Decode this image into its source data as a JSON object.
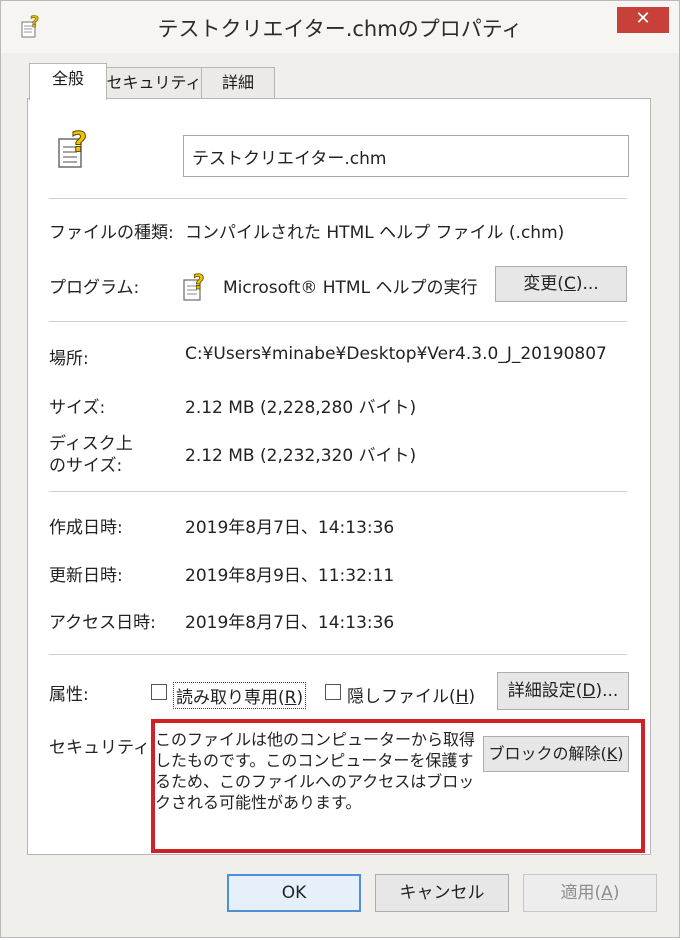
{
  "window": {
    "title": "テストクリエイター.chmのプロパティ",
    "close_glyph": "✕"
  },
  "tabs": [
    {
      "label": "全般"
    },
    {
      "label": "セキュリティ"
    },
    {
      "label": "詳細"
    }
  ],
  "general": {
    "file_name": "テストクリエイター.chm",
    "file_type_label": "ファイルの種類:",
    "file_type_value": "コンパイルされた HTML ヘルプ ファイル (.chm)",
    "program_label": "プログラム:",
    "program_value": "Microsoft® HTML ヘルプの実行",
    "change_button": {
      "prefix": "変更(",
      "key": "C",
      "suffix": ")..."
    },
    "location_label": "場所:",
    "location_value": "C:¥Users¥minabe¥Desktop¥Ver4.3.0_J_20190807",
    "size_label": "サイズ:",
    "size_value": "2.12 MB (2,228,280 バイト)",
    "disk_size_label_1": "ディスク上",
    "disk_size_label_2": "のサイズ:",
    "disk_size_value": "2.12 MB (2,232,320 バイト)",
    "created_label": "作成日時:",
    "created_value": "2019年8月7日、14:13:36",
    "modified_label": "更新日時:",
    "modified_value": "2019年8月9日、11:32:11",
    "accessed_label": "アクセス日時:",
    "accessed_value": "2019年8月7日、14:13:36",
    "attributes_label": "属性:",
    "readonly": {
      "prefix": "読み取り専用(",
      "key": "R",
      "suffix": ")",
      "checked": false
    },
    "hidden": {
      "prefix": "隠しファイル(",
      "key": "H",
      "suffix": ")",
      "checked": false
    },
    "advanced_button": {
      "prefix": "詳細設定(",
      "key": "D",
      "suffix": ")..."
    },
    "security_label": "セキュリティ:",
    "security_text": "このファイルは他のコンピューターから取得したものです。このコンピューターを保護するため、このファイルへのアクセスはブロックされる可能性があります。",
    "unblock_button": {
      "prefix": "ブロックの解除(",
      "key": "K",
      "suffix": ")"
    }
  },
  "footer": {
    "ok_label": "OK",
    "cancel_label": "キャンセル",
    "apply_button": {
      "prefix": "適用(",
      "key": "A",
      "suffix": ")"
    }
  },
  "colors": {
    "highlight_border": "#cf2128",
    "close_button": "#c7403a",
    "default_button_border": "#4f8fd6"
  },
  "icons": {
    "file_icon": "chm-help-file-icon",
    "program_icon": "chm-help-program-icon"
  }
}
